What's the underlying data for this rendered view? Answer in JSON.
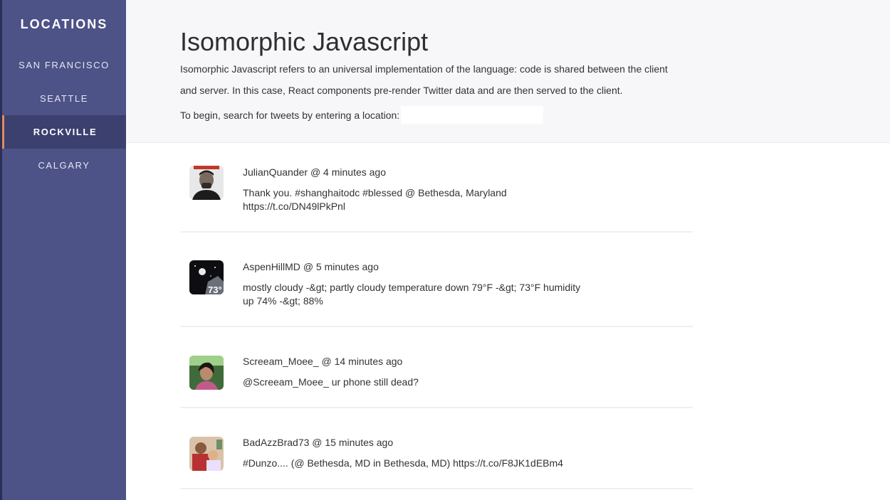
{
  "sidebar": {
    "title": "LOCATIONS",
    "items": [
      {
        "label": "SAN FRANCISCO",
        "active": false
      },
      {
        "label": "SEATTLE",
        "active": false
      },
      {
        "label": "ROCKVILLE",
        "active": true
      },
      {
        "label": "CALGARY",
        "active": false
      }
    ]
  },
  "header": {
    "title": "Isomorphic Javascript",
    "description": "Isomorphic Javascript refers to an universal implementation of the language: code is shared between the client and server. In this case, React components pre-render Twitter data and are then served to the client.",
    "prompt": "To begin, search for tweets by entering a location:",
    "location_input": {
      "value": "",
      "placeholder": ""
    }
  },
  "tweets": [
    {
      "user": "JulianQuander",
      "time": "@ 4 minutes ago",
      "text": "Thank you. #shanghaitodc #blessed @ Bethesda, Maryland https://t.co/DN49lPkPnl",
      "avatar": "portrait-avatar"
    },
    {
      "user": "AspenHillMD",
      "time": "@ 5 minutes ago",
      "text": "mostly cloudy -&gt; partly cloudy temperature down 79°F -&gt; 73°F humidity up 74% -&gt; 88%",
      "avatar": "weather-avatar",
      "avatar_text": "73°"
    },
    {
      "user": "Screeam_Moee_",
      "time": "@ 14 minutes ago",
      "text": "@Screeam_Moee_ ur phone still dead?",
      "avatar": "photo-avatar"
    },
    {
      "user": "BadAzzBrad73",
      "time": "@ 15 minutes ago",
      "text": "#Dunzo.... (@ Bethesda, MD in Bethesda, MD) https://t.co/F8JK1dEBm4",
      "avatar": "family-avatar"
    }
  ],
  "colors": {
    "sidebar_bg": "#4d5287",
    "sidebar_active_bg": "#3c406f",
    "active_accent": "#e08a5d",
    "header_bg": "#f7f7f9"
  }
}
